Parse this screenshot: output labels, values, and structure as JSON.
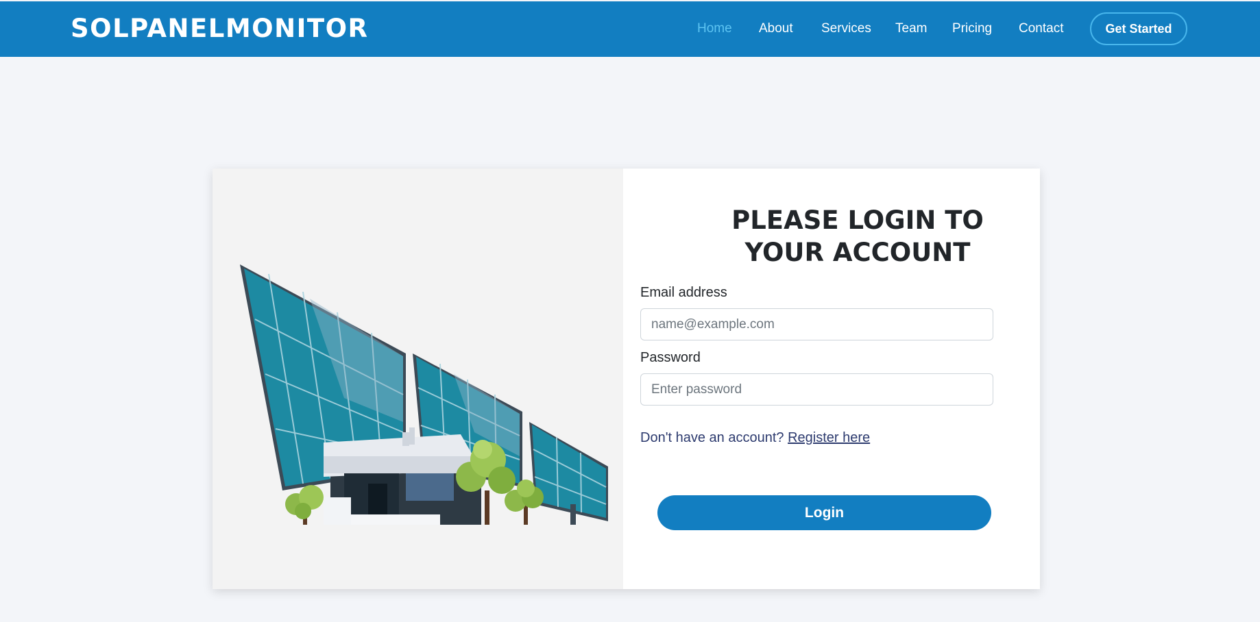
{
  "header": {
    "logo": "SOLPANELMONITOR",
    "nav": [
      {
        "label": "Home",
        "active": true
      },
      {
        "label": "About"
      },
      {
        "label": "Services"
      },
      {
        "label": "Team"
      },
      {
        "label": "Pricing"
      },
      {
        "label": "Contact"
      }
    ],
    "cta_label": "Get Started"
  },
  "login": {
    "title": "PLEASE LOGIN TO YOUR ACCOUNT",
    "email_label": "Email address",
    "email_placeholder": "name@example.com",
    "email_value": "",
    "password_label": "Password",
    "password_placeholder": "Enter password",
    "password_value": "",
    "register_prompt": "Don't have an account?",
    "register_link": "Register here",
    "submit_label": "Login"
  },
  "illustration": {
    "icon": "solar-panel-building-illustration"
  },
  "colors": {
    "brand": "#127ec1",
    "nav_active": "#5dc4f2",
    "background": "#f3f5f9",
    "panel_teal": "#137f94"
  }
}
